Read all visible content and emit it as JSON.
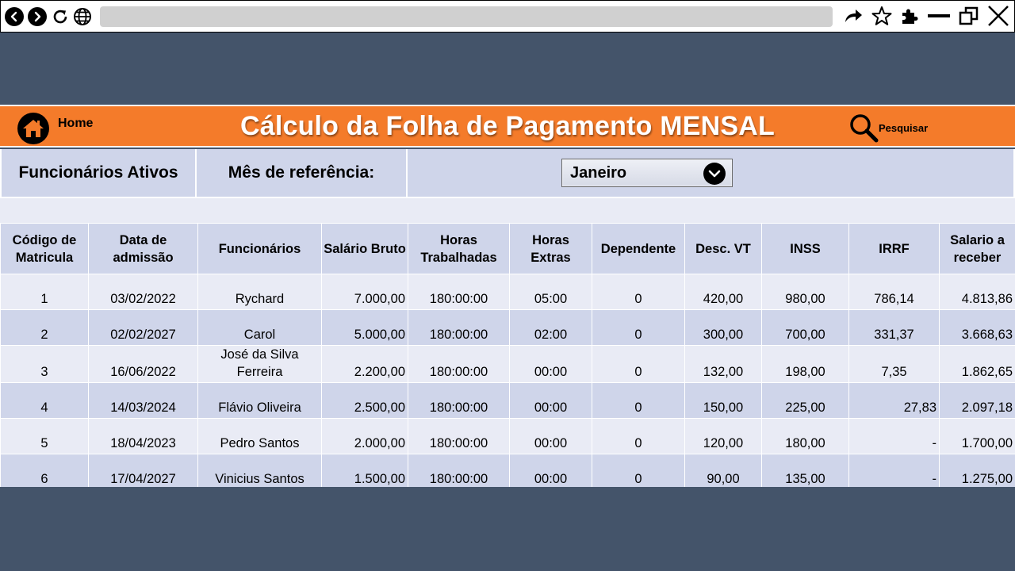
{
  "header": {
    "home_label": "Home",
    "title": "Cálculo da Folha de Pagamento MENSAL",
    "search_label": "Pesquisar"
  },
  "filters": {
    "active_employees": "Funcionários Ativos",
    "reference_month_label": "Mês de referência:",
    "month_value": "Janeiro"
  },
  "table": {
    "columns": [
      "Código de Matricula",
      "Data de admissão",
      "Funcionários",
      "Salário Bruto",
      "Horas Trabalhadas",
      "Horas Extras",
      "Dependente",
      "Desc. VT",
      "INSS",
      "IRRF",
      "Salario a receber"
    ],
    "rows": [
      [
        "1",
        "03/02/2022",
        "Rychard",
        "7.000,00",
        "180:00:00",
        "05:00",
        "0",
        "420,00",
        "980,00",
        "786,14",
        "4.813,86"
      ],
      [
        "2",
        "02/02/2027",
        "Carol",
        "5.000,00",
        "180:00:00",
        "02:00",
        "0",
        "300,00",
        "700,00",
        "331,37",
        "3.668,63"
      ],
      [
        "3",
        "16/06/2022",
        "José da Silva Ferreira",
        "2.200,00",
        "180:00:00",
        "00:00",
        "0",
        "132,00",
        "198,00",
        "7,35",
        "1.862,65"
      ],
      [
        "4",
        "14/03/2024",
        "Flávio Oliveira",
        "2.500,00",
        "180:00:00",
        "00:00",
        "0",
        "150,00",
        "225,00",
        "27,83",
        "2.097,18"
      ],
      [
        "5",
        "18/04/2023",
        "Pedro Santos",
        "2.000,00",
        "180:00:00",
        "00:00",
        "0",
        "120,00",
        "180,00",
        "-",
        "1.700,00"
      ],
      [
        "6",
        "17/04/2027",
        "Vinicius Santos",
        "1.500,00",
        "180:00:00",
        "00:00",
        "0",
        "90,00",
        "135,00",
        "-",
        "1.275,00"
      ]
    ]
  },
  "colors": {
    "header_orange": "#f47b2a",
    "background": "#44546a",
    "row_light": "#e9ebf5",
    "row_dark": "#cfd5ea"
  }
}
